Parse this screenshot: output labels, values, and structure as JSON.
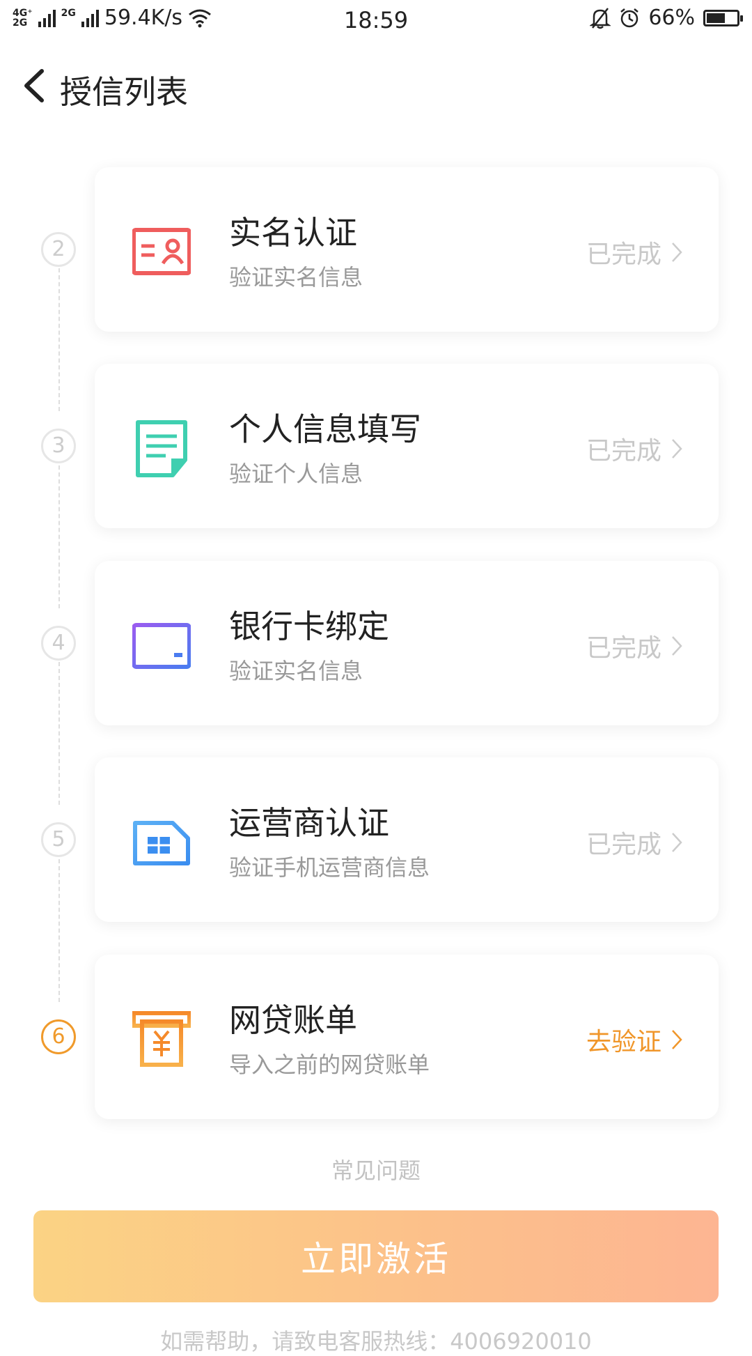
{
  "status_bar": {
    "network_top": "4G⁺",
    "network_bottom": "2G",
    "network2": "2G",
    "speed": "59.4K/s",
    "time": "18:59",
    "battery": "66%",
    "battery_level": 0.66
  },
  "header": {
    "title": "授信列表"
  },
  "steps": [
    {
      "num": "2",
      "title": "实名认证",
      "subtitle": "验证实名信息",
      "status": "已完成",
      "icon": "id-card-icon",
      "color": "#ee5a5a"
    },
    {
      "num": "3",
      "title": "个人信息填写",
      "subtitle": "验证个人信息",
      "status": "已完成",
      "icon": "document-icon",
      "color": "#3fcfb0"
    },
    {
      "num": "4",
      "title": "银行卡绑定",
      "subtitle": "验证实名信息",
      "status": "已完成",
      "icon": "bank-card-icon",
      "color": "#7a6cf0"
    },
    {
      "num": "5",
      "title": "运营商认证",
      "subtitle": "验证手机运营商信息",
      "status": "已完成",
      "icon": "sim-card-icon",
      "color": "#4aa6f0"
    },
    {
      "num": "6",
      "title": "网贷账单",
      "subtitle": "导入之前的网贷账单",
      "status": "去验证",
      "icon": "bill-icon",
      "color": "#f5a13a"
    }
  ],
  "faq_label": "常见问题",
  "activate_label": "立即激活",
  "hotline_text": "如需帮助，请致电客服热线：4006920010"
}
